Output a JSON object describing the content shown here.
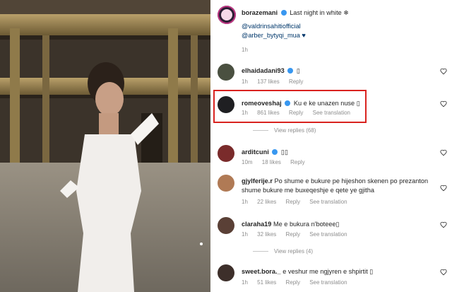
{
  "caption": {
    "username": "borazemani",
    "text": "Last night in white ❄",
    "mention1": "@valdrinsahitiofficial",
    "mention2": "@arber_bytyqi_mua ♥",
    "time": "1h"
  },
  "comments": [
    {
      "username": "elhaidadani93",
      "text": "▯",
      "time": "1h",
      "likes": "137 likes",
      "reply": "Reply",
      "translate": "",
      "view": ""
    },
    {
      "username": "romeoveshaj",
      "text": "Ku e ke unazen nuse ▯",
      "time": "1h",
      "likes": "861 likes",
      "reply": "Reply",
      "translate": "See translation",
      "view": "View replies (68)"
    },
    {
      "username": "arditcuni",
      "text": "▯▯",
      "time": "10m",
      "likes": "18 likes",
      "reply": "Reply",
      "translate": "",
      "view": ""
    },
    {
      "username": "gjylferije.r",
      "text": "Po shume e bukure pe hijeshon skenen po prezanton shume bukure me buxeqeshje e qete ye gjitha",
      "time": "1h",
      "likes": "22 likes",
      "reply": "Reply",
      "translate": "See translation",
      "view": ""
    },
    {
      "username": "claraha19",
      "text": "Me e bukura n'boteee▯",
      "time": "1h",
      "likes": "32 likes",
      "reply": "Reply",
      "translate": "See translation",
      "view": "View replies (4)"
    },
    {
      "username": "sweet.bora._",
      "text": "e veshur me ngjyren e shpirtit ▯",
      "time": "1h",
      "likes": "51 likes",
      "reply": "Reply",
      "translate": "See translation",
      "view": ""
    }
  ]
}
